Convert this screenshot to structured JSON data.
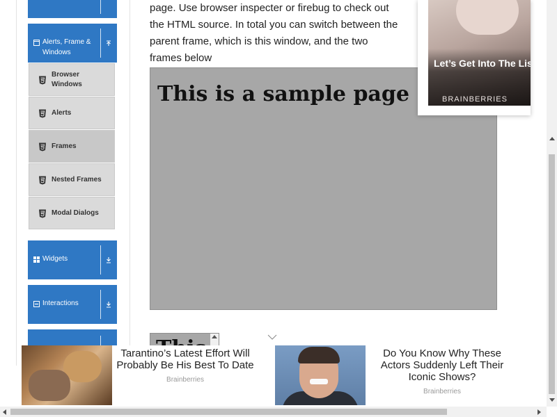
{
  "sidebar": {
    "groups": [
      {
        "label": "",
        "arrow": "collapse"
      },
      {
        "label": "Alerts, Frame & Windows",
        "arrow": "collapse"
      },
      {
        "label": "Widgets",
        "arrow": "expand"
      },
      {
        "label": "Interactions",
        "arrow": "expand"
      },
      {
        "label": "",
        "arrow": "expand"
      }
    ],
    "items": [
      {
        "label": "Browser Windows"
      },
      {
        "label": "Alerts"
      },
      {
        "label": "Frames",
        "active": true
      },
      {
        "label": "Nested Frames"
      },
      {
        "label": "Modal Dialogs"
      }
    ],
    "accent_color": "#2f78c4"
  },
  "main": {
    "intro_text": "page. Use browser inspecter or firebug to check out the HTML source. In total you can switch between the parent frame, which is this window, and the two frames below",
    "frame1_heading": "This is a sample page",
    "frame2_heading": "This"
  },
  "ad_top": {
    "headline": "Let’s Get Into The List Of Japanese Horrors You M",
    "brand": "BRAINBERRIES"
  },
  "ad_bottom": {
    "cards": [
      {
        "title": "Tarantino’s Latest Effort Will Probably Be His Best To Date",
        "source": "Brainberries"
      },
      {
        "title": "Do You Know Why These Actors Suddenly Left Their Iconic Shows?",
        "source": "Brainberries"
      }
    ]
  }
}
